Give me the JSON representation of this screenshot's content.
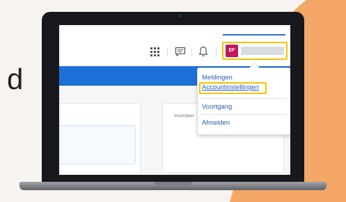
{
  "page": {
    "partial_text": "d"
  },
  "header": {
    "avatar_initials": "EF",
    "icons": [
      "grid-icon",
      "chat-icon",
      "bell-icon"
    ]
  },
  "main": {
    "card_label": "Inschrijven"
  },
  "dropdown": {
    "items": [
      {
        "label": "Meldingen"
      },
      {
        "label": "Accountinstellingen"
      },
      {
        "label": "Voortgang"
      },
      {
        "label": "Afmelden"
      }
    ]
  },
  "colors": {
    "accent_blue": "#1d6fd8",
    "highlight_yellow": "#f2c400",
    "avatar_magenta": "#c2185b",
    "link_blue": "#2b5db8",
    "backdrop_orange": "#f4a766"
  }
}
